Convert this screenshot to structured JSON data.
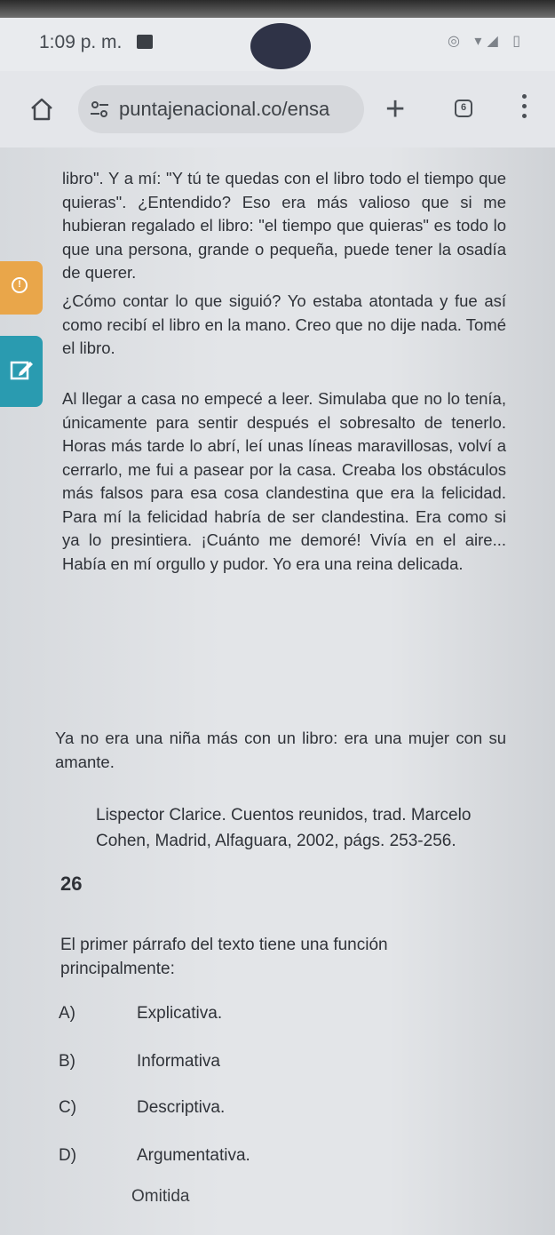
{
  "status_bar": {
    "time": "1:09 p. m."
  },
  "browser": {
    "url": "puntajenacional.co/ensa",
    "tab_count": "6"
  },
  "reading": {
    "paragraphs": [
      "libro\". Y a mí: \"Y tú te quedas con el libro todo el tiempo que quieras\". ¿Entendido? Eso era más valioso que si me hubieran regalado el libro: \"el tiempo que quieras\" es todo lo que una persona, grande o pequeña, puede tener la osadía de querer.",
      "¿Cómo contar lo que siguió? Yo estaba atontada y fue así como recibí el libro en la mano. Creo que no dije nada. Tomé el libro.",
      "Al llegar a casa no empecé a leer. Simulaba que no lo tenía, únicamente para sentir después el sobresalto de tenerlo. Horas más tarde lo abrí, leí unas líneas maravillosas, volví a cerrarlo, me fui a pasear por la casa. Creaba los obstáculos más falsos para esa cosa clandestina que era la felicidad. Para mí la felicidad habría de ser clandestina. Era como si ya lo presintiera. ¡Cuánto me demoré! Vivía en el aire... Había en mí orgullo y pudor. Yo era una reina delicada.",
      "Ya no era una niña más con un libro: era una mujer con su amante."
    ],
    "citation": "Lispector Clarice. Cuentos reunidos, trad. Marcelo Cohen, Madrid, Alfaguara, 2002, págs. 253-256."
  },
  "question": {
    "number": "26",
    "prompt": "El primer párrafo del texto tiene una función principalmente:",
    "options": [
      {
        "letter": "A)",
        "label": "Explicativa."
      },
      {
        "letter": "B)",
        "label": "Informativa"
      },
      {
        "letter": "C)",
        "label": "Descriptiva."
      },
      {
        "letter": "D)",
        "label": "Argumentativa."
      }
    ],
    "omit_label": "Omitida"
  },
  "icons": {
    "home": "home-icon",
    "site_settings": "tune-icon",
    "new_tab": "plus-icon",
    "menu": "more-vert-icon",
    "alert_tab": "clock-icon",
    "edit_tab": "pencil-icon"
  },
  "colors": {
    "alert_tab": "#e9a64a",
    "edit_tab": "#2a9bb0"
  }
}
